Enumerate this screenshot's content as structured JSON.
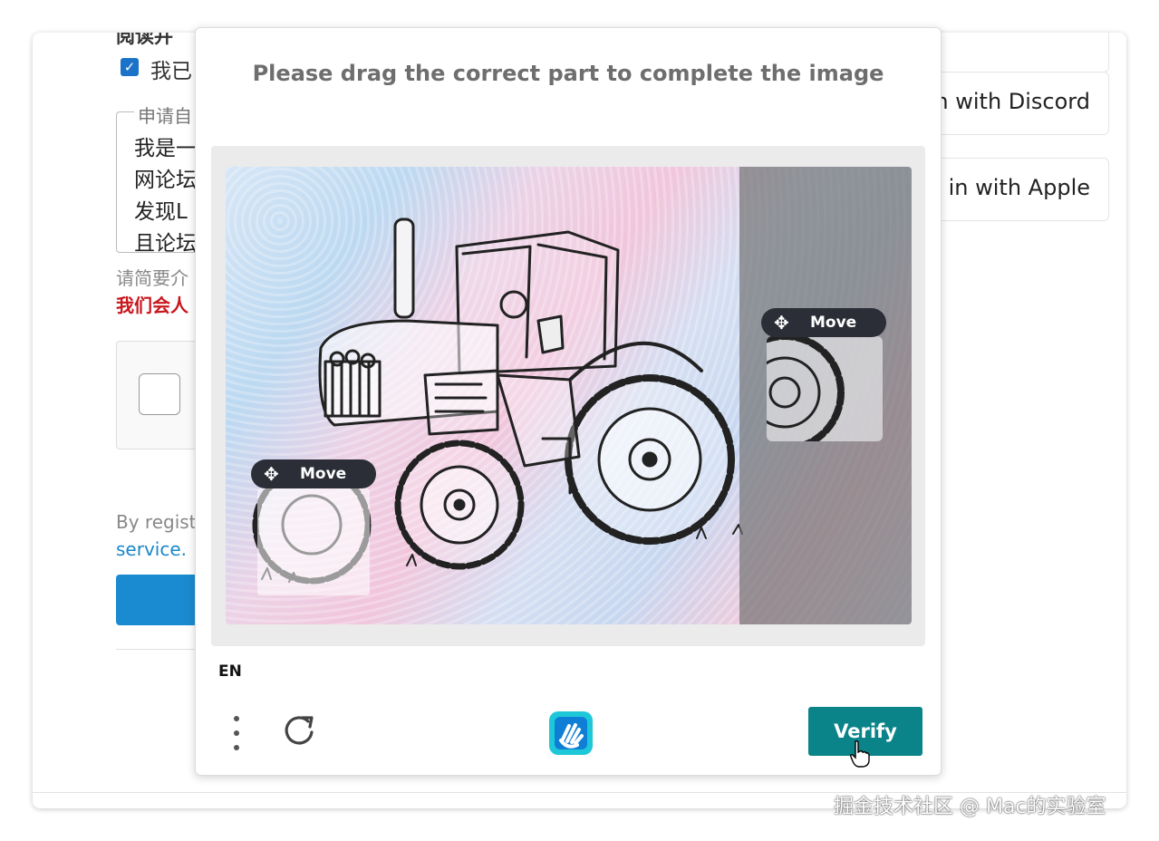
{
  "background": {
    "heading": "阅读并",
    "checkbox_label": "我已",
    "intro_legend": "申请自",
    "intro_lines": [
      "我是一",
      "网论坛",
      "发现L",
      "且论坛"
    ],
    "hint": "请简要介",
    "warning": "我们会人",
    "terms_text": "By regist",
    "terms_link": "service.",
    "social_discord": "n with Discord",
    "social_apple": "in with Apple"
  },
  "captcha": {
    "prompt": "Please drag the correct part to complete the image",
    "move_label_left": "Move",
    "move_label_right": "Move",
    "move_icon": "move-arrows-icon",
    "language": "EN",
    "menu_icon": "vertical-dots-icon",
    "refresh_icon": "refresh-icon",
    "logo_icon": "hcaptcha-hand-logo",
    "verify_label": "Verify",
    "accent_color": "#0a8489"
  },
  "watermark": "掘金技术社区 @ Mac的实验室"
}
